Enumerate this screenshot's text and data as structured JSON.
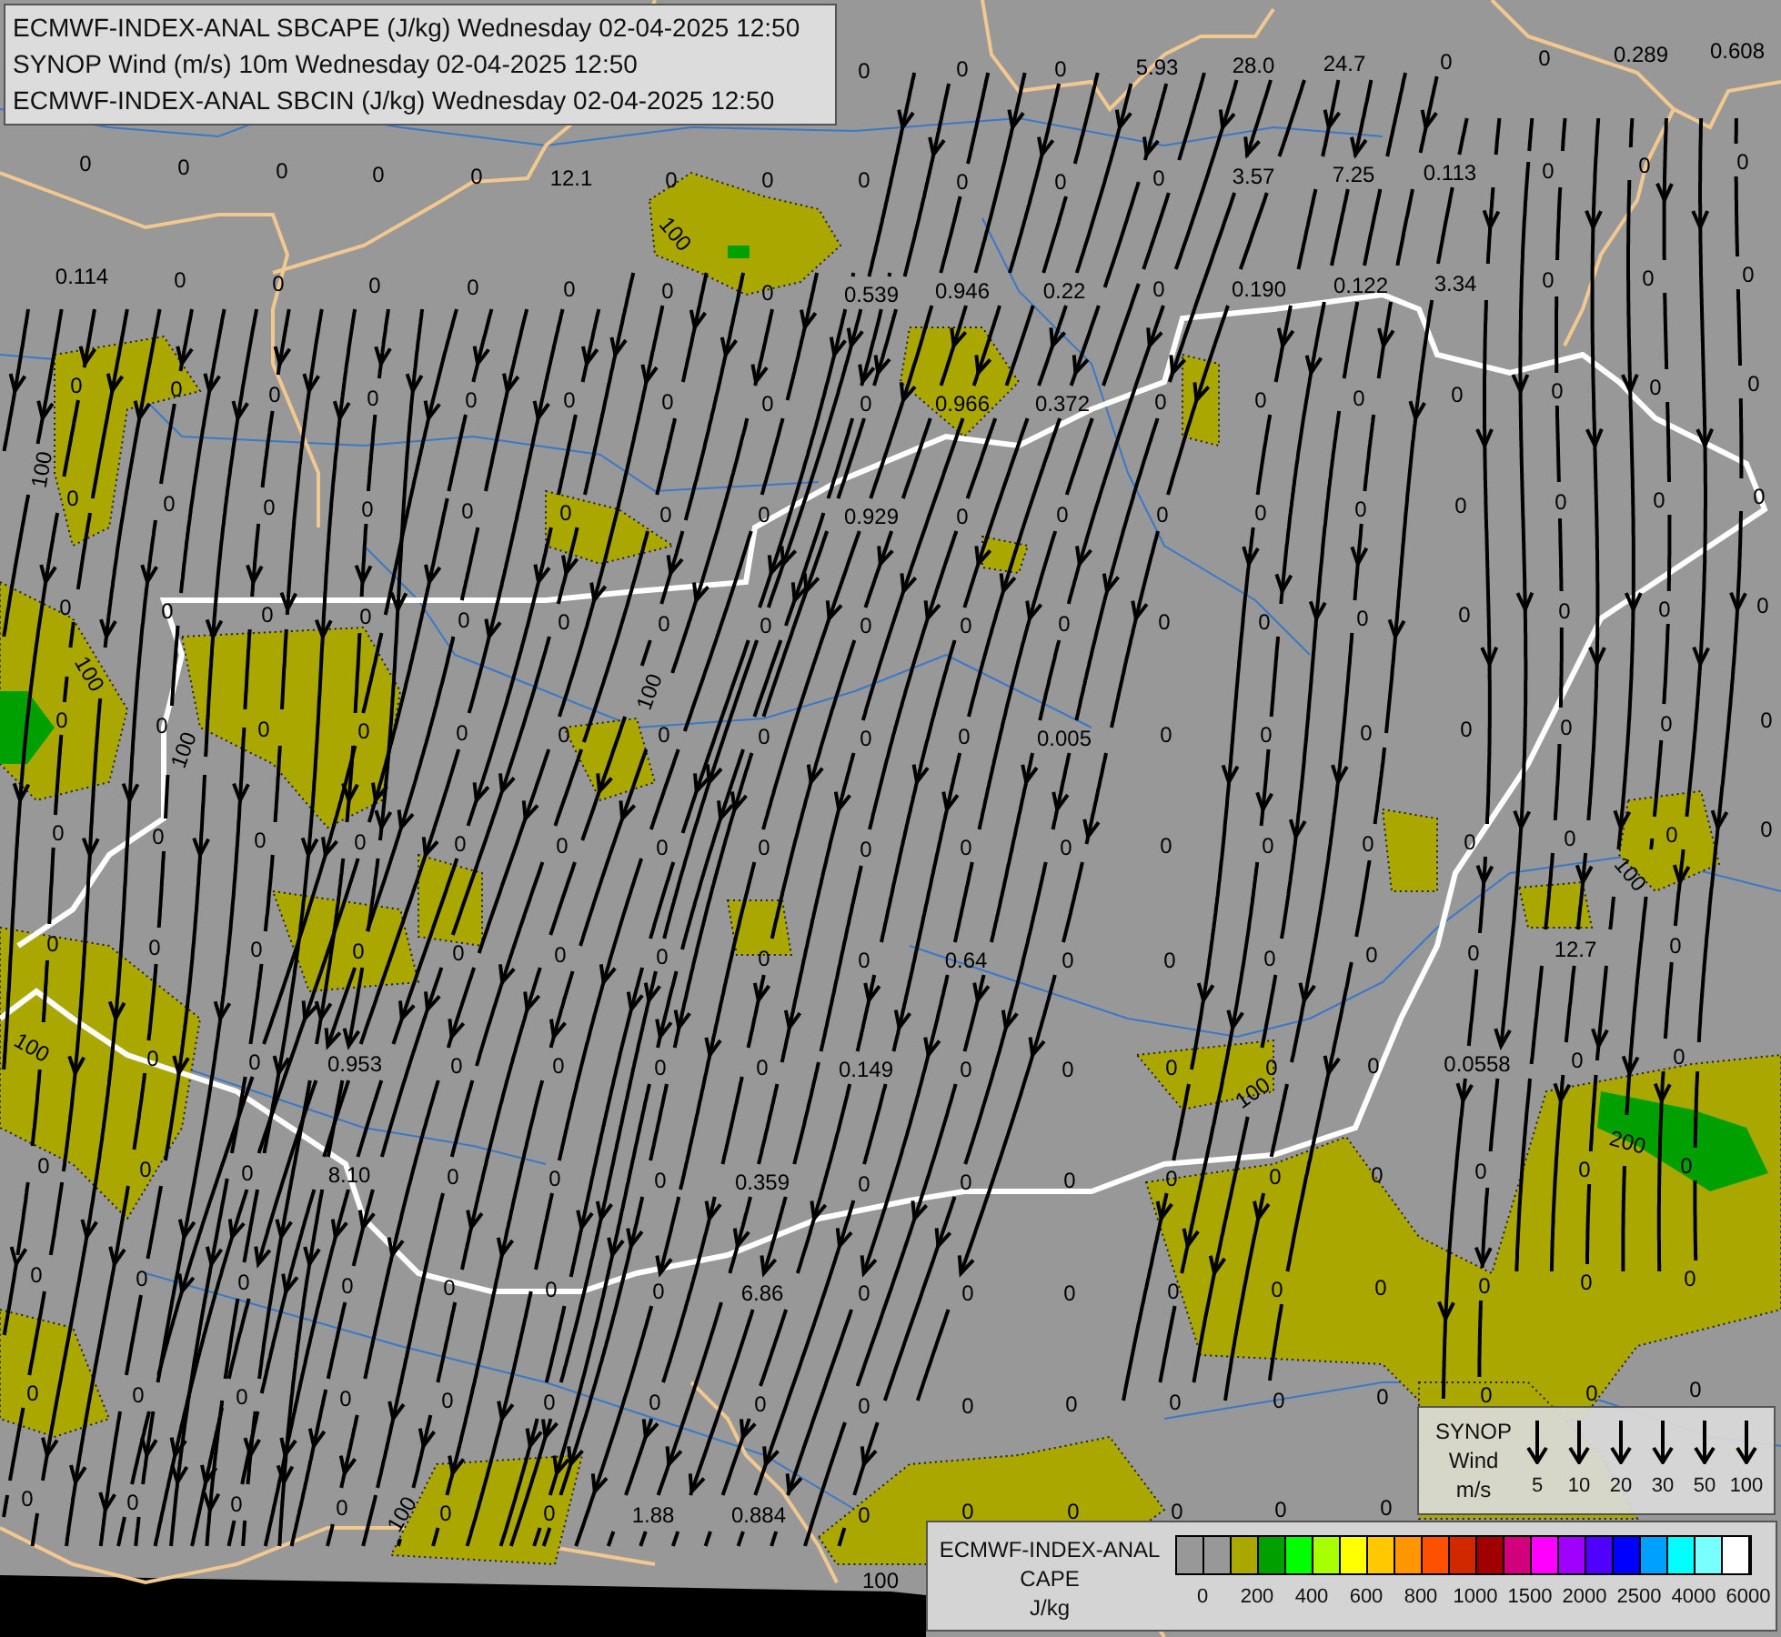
{
  "header": {
    "lines": [
      "ECMWF-INDEX-ANAL SBCAPE (J/kg) Wednesday 02-04-2025 12:50",
      "SYNOP Wind (m/s) 10m Wednesday 02-04-2025 12:50",
      "ECMWF-INDEX-ANAL SBCIN (J/kg) Wednesday 02-04-2025 12:50"
    ]
  },
  "map": {
    "station_values": [
      "0",
      "0",
      "0",
      "5.93",
      "28.0",
      "24.7",
      "0",
      "0",
      "0.289",
      "0.608",
      "0",
      "0",
      "0",
      "0",
      "0",
      "12.1",
      "0",
      "0",
      "0",
      "0",
      "0",
      "0",
      "3.57",
      "7.25",
      "0.113",
      "0",
      "0",
      "0",
      "0.114",
      "0",
      "0",
      "0",
      "0",
      "0",
      "0",
      "0",
      "0.539",
      "0.946",
      "0.22",
      "0",
      "0.190",
      "0.122",
      "3.34",
      "0",
      "0",
      "0",
      "0",
      "0",
      "0",
      "0",
      "0",
      "0",
      "0",
      "0",
      "0",
      "0.966",
      "0.372",
      "0",
      "0",
      "0",
      "0",
      "0",
      "0",
      "0",
      "0",
      "0",
      "0",
      "0",
      "0",
      "0",
      "0",
      "0",
      "0.929",
      "0",
      "0",
      "0",
      "0",
      "0",
      "0",
      "0",
      "0",
      "0",
      "0",
      "0",
      "0",
      "0",
      "0",
      "0",
      "0",
      "0",
      "0",
      "0",
      "0",
      "0",
      "0",
      "0",
      "0",
      "0",
      "0",
      "0",
      "0",
      "0",
      "0",
      "0",
      "0",
      "0",
      "0",
      "0",
      "0",
      "0",
      "0.005",
      "0",
      "0",
      "0",
      "0",
      "0",
      "0",
      "0",
      "0",
      "0",
      "0",
      "0",
      "0",
      "0",
      "0",
      "0",
      "0",
      "0",
      "0",
      "0",
      "0",
      "0",
      "0",
      "0",
      "0",
      "0",
      "0",
      "0",
      "0",
      "0",
      "0",
      "0",
      "0",
      "0",
      "0",
      "0.64",
      "0",
      "0",
      "0",
      "0",
      "0",
      "12.7",
      "0",
      "0",
      "0",
      "0.953",
      "0",
      "0",
      "0",
      "0",
      "0.149",
      "0",
      "0",
      "0",
      "0",
      "0",
      "0.0558",
      "0",
      "0",
      "0",
      "0",
      "0",
      "8.10",
      "0",
      "0",
      "0",
      "0.359",
      "0",
      "0",
      "0",
      "0",
      "0",
      "0",
      "0",
      "0",
      "0",
      "0",
      "0",
      "0",
      "0",
      "0",
      "0",
      "0",
      "6.86",
      "0",
      "0",
      "0",
      "0",
      "0",
      "0",
      "0",
      "0",
      "0",
      "0",
      "0",
      "0",
      "0",
      "0",
      "0",
      "0",
      "0",
      "0",
      "0",
      "0",
      "0",
      "0",
      "0",
      "0",
      "0",
      "0",
      "0",
      "0",
      "0",
      "0",
      "0",
      "0",
      "1.88",
      "0.884",
      "0",
      "0",
      "0",
      "0",
      "0",
      "0"
    ],
    "contour_labels": [
      "100",
      "100",
      "100",
      "100",
      "100",
      "100",
      "100",
      "200",
      "100",
      "100",
      "100"
    ]
  },
  "wind_legend": {
    "title_lines": [
      "SYNOP",
      "Wind",
      "m/s"
    ],
    "speeds": [
      "5",
      "10",
      "20",
      "30",
      "50",
      "100"
    ]
  },
  "cape_legend": {
    "title_lines": [
      "ECMWF-INDEX-ANAL",
      "CAPE"
    ],
    "unit": "J/kg",
    "swatches": [
      {
        "color": "#989898"
      },
      {
        "color": "#989898"
      },
      {
        "color": "#aaa800"
      },
      {
        "color": "#00a000"
      },
      {
        "color": "#00ff00"
      },
      {
        "color": "#a8ff00"
      },
      {
        "color": "#ffff00"
      },
      {
        "color": "#ffc800"
      },
      {
        "color": "#ff9600"
      },
      {
        "color": "#ff5000"
      },
      {
        "color": "#d22800"
      },
      {
        "color": "#a00000"
      },
      {
        "color": "#d2007d"
      },
      {
        "color": "#ff00ff"
      },
      {
        "color": "#a000ff"
      },
      {
        "color": "#5000ff"
      },
      {
        "color": "#0000ff"
      },
      {
        "color": "#00a0ff"
      },
      {
        "color": "#00ffff"
      },
      {
        "color": "#78ffff"
      },
      {
        "color": "#ffffff"
      }
    ],
    "ticks": [
      "0",
      "200",
      "400",
      "600",
      "800",
      "1000",
      "1500",
      "2000",
      "2500",
      "4000",
      "6000"
    ]
  }
}
